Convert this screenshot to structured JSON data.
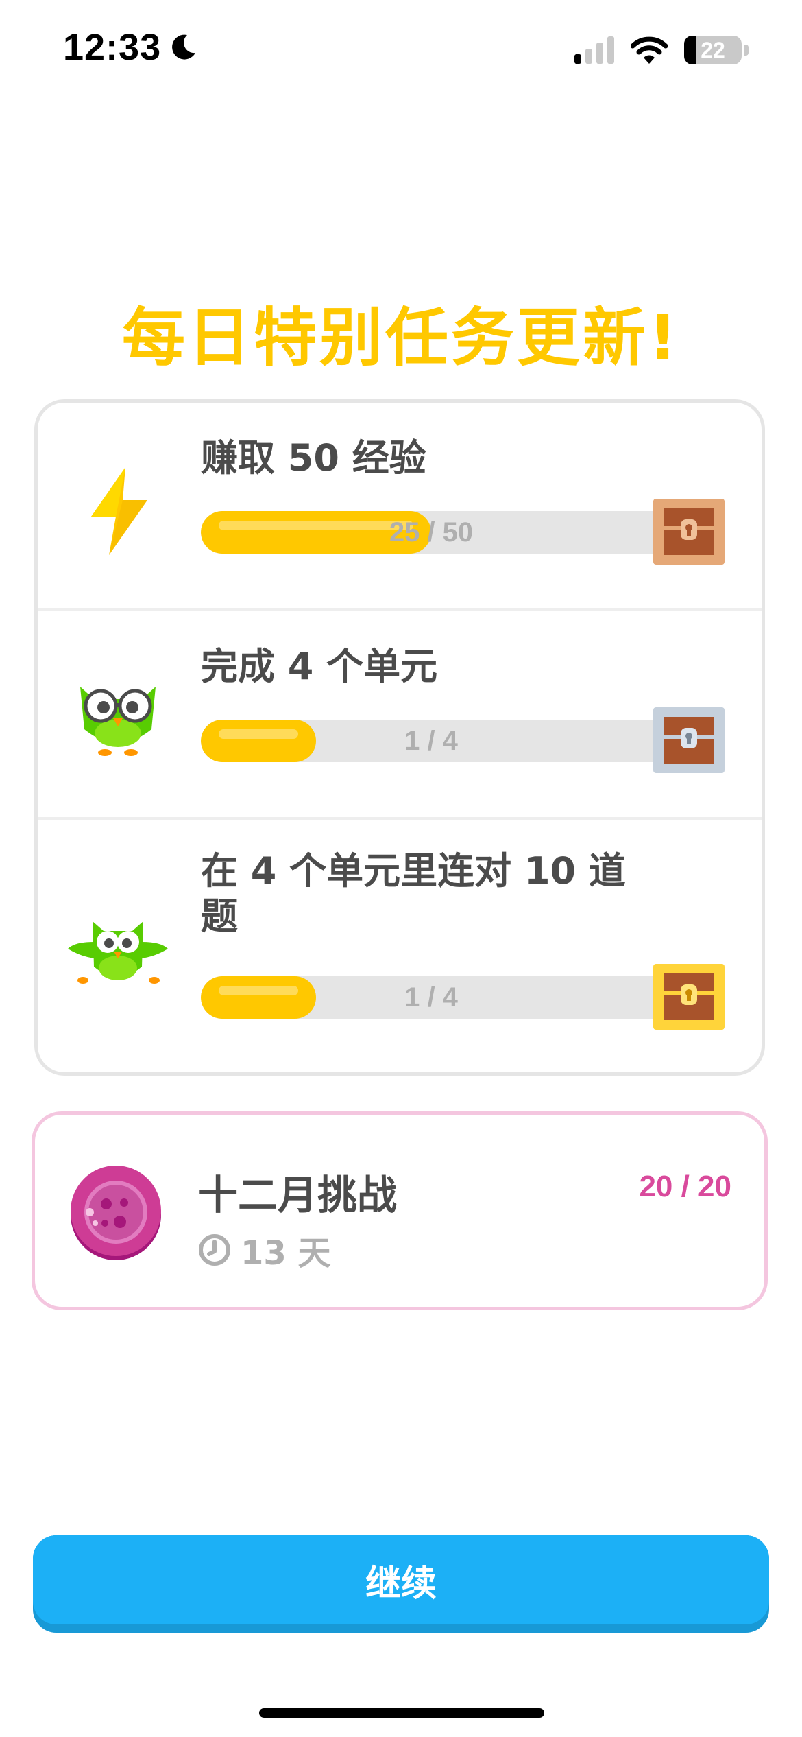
{
  "status": {
    "time": "12:33",
    "battery": "22",
    "battery_level": 0.22
  },
  "title": "每日特别任务更新!",
  "quests": [
    {
      "title": "赚取 50 经验",
      "progress_text": "25 / 50",
      "progress": 0.5,
      "icon": "lightning-bolt-icon",
      "chest": "bronze-chest-icon"
    },
    {
      "title": "完成 4 个单元",
      "progress_text": "1 / 4",
      "progress": 0.25,
      "icon": "owl-with-glasses-icon",
      "chest": "silver-chest-icon"
    },
    {
      "title": "在 4 个单元里连对 10 道题",
      "progress_text": "1 / 4",
      "progress": 0.25,
      "icon": "owl-flying-icon",
      "chest": "gold-chest-icon"
    }
  ],
  "challenge": {
    "title": "十二月挑战",
    "days": "13 天",
    "count": "20 / 20",
    "icon": "monthly-badge-icon"
  },
  "continue_label": "继续",
  "colors": {
    "gold": "#ffc800",
    "blue": "#1cb0f6",
    "pink": "#d94a9c",
    "gray": "#e5e5e5"
  }
}
